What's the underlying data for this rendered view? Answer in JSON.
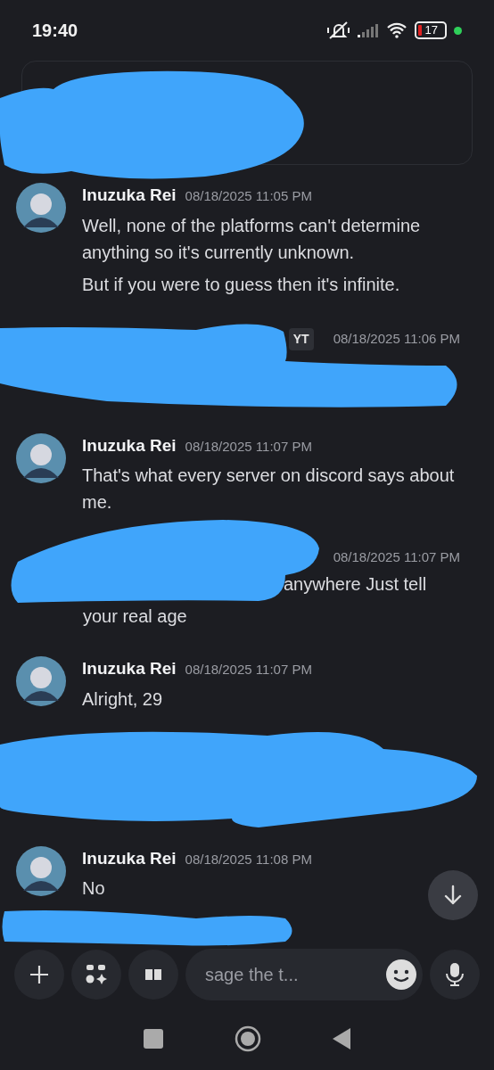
{
  "status_bar": {
    "time": "19:40",
    "battery": "17"
  },
  "messages": [
    {
      "kind": "full",
      "author": "Inuzuka Rei",
      "time": "08/18/2025 11:05 PM",
      "paragraphs": [
        "Well, none of the platforms can't determine anything so it's currently unknown.",
        "But if you were to guess then it's infinite."
      ]
    },
    {
      "kind": "redacted",
      "badge": "YT",
      "time": "08/18/2025 11:06 PM"
    },
    {
      "kind": "full",
      "author": "Inuzuka Rei",
      "time": "08/18/2025 11:07 PM",
      "paragraphs": [
        "That's what every server on discord says about me."
      ]
    },
    {
      "kind": "redacted",
      "time": "08/18/2025 11:07 PM",
      "paragraphs": [
        "anywhere Just tell",
        "your real age"
      ]
    },
    {
      "kind": "full",
      "author": "Inuzuka Rei",
      "time": "08/18/2025 11:07 PM",
      "paragraphs": [
        "Alright, 29"
      ]
    },
    {
      "kind": "hidden"
    },
    {
      "kind": "full",
      "author": "Inuzuka Rei",
      "time": "08/18/2025 11:08 PM",
      "paragraphs": [
        "No"
      ]
    }
  ],
  "composer": {
    "placeholder": "sage the t..."
  }
}
